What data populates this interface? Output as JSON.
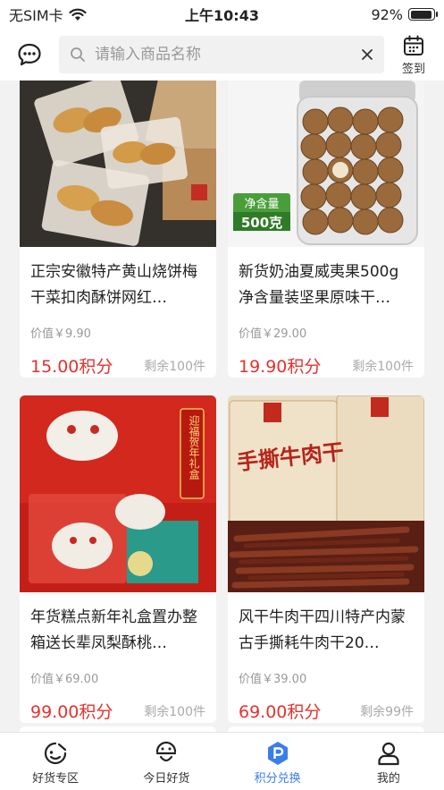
{
  "status_bar": {
    "carrier": "无SIM卡",
    "time": "上午10:43",
    "battery": "92%",
    "battery_level": 0.92
  },
  "header": {
    "search_placeholder": "请输入商品名称",
    "signin_label": "签到"
  },
  "products": [
    {
      "title": "正宗安徽特产黄山烧饼梅干菜扣肉酥饼网红…",
      "value": "价值￥9.90",
      "points": "15.00积分",
      "remaining": "剩余100件"
    },
    {
      "title": "新货奶油夏威夷果500g净含量装坚果原味干…",
      "value": "价值￥29.00",
      "points": "19.90积分",
      "remaining": "剩余100件",
      "badge_top": "净含量",
      "badge_bottom": "500克"
    },
    {
      "title": "年货糕点新年礼盒置办整箱送长辈凤梨酥桃…",
      "value": "价值￥69.00",
      "points": "99.00积分",
      "remaining": "剩余100件",
      "banner_text": "迎福贺年礼盒"
    },
    {
      "title": "风干牛肉干四川特产内蒙古手撕耗牛肉干20…",
      "value": "价值￥39.00",
      "points": "69.00积分",
      "remaining": "剩余99件",
      "pkg_text": "手撕牛肉干"
    }
  ],
  "tabs": [
    {
      "label": "好货专区",
      "icon": "goods-icon"
    },
    {
      "label": "今日好货",
      "icon": "today-icon"
    },
    {
      "label": "积分兑换",
      "icon": "points-icon",
      "active": true
    },
    {
      "label": "我的",
      "icon": "profile-icon"
    }
  ],
  "colors": {
    "accent": "#3a7ee8",
    "points": "#e5322d"
  }
}
